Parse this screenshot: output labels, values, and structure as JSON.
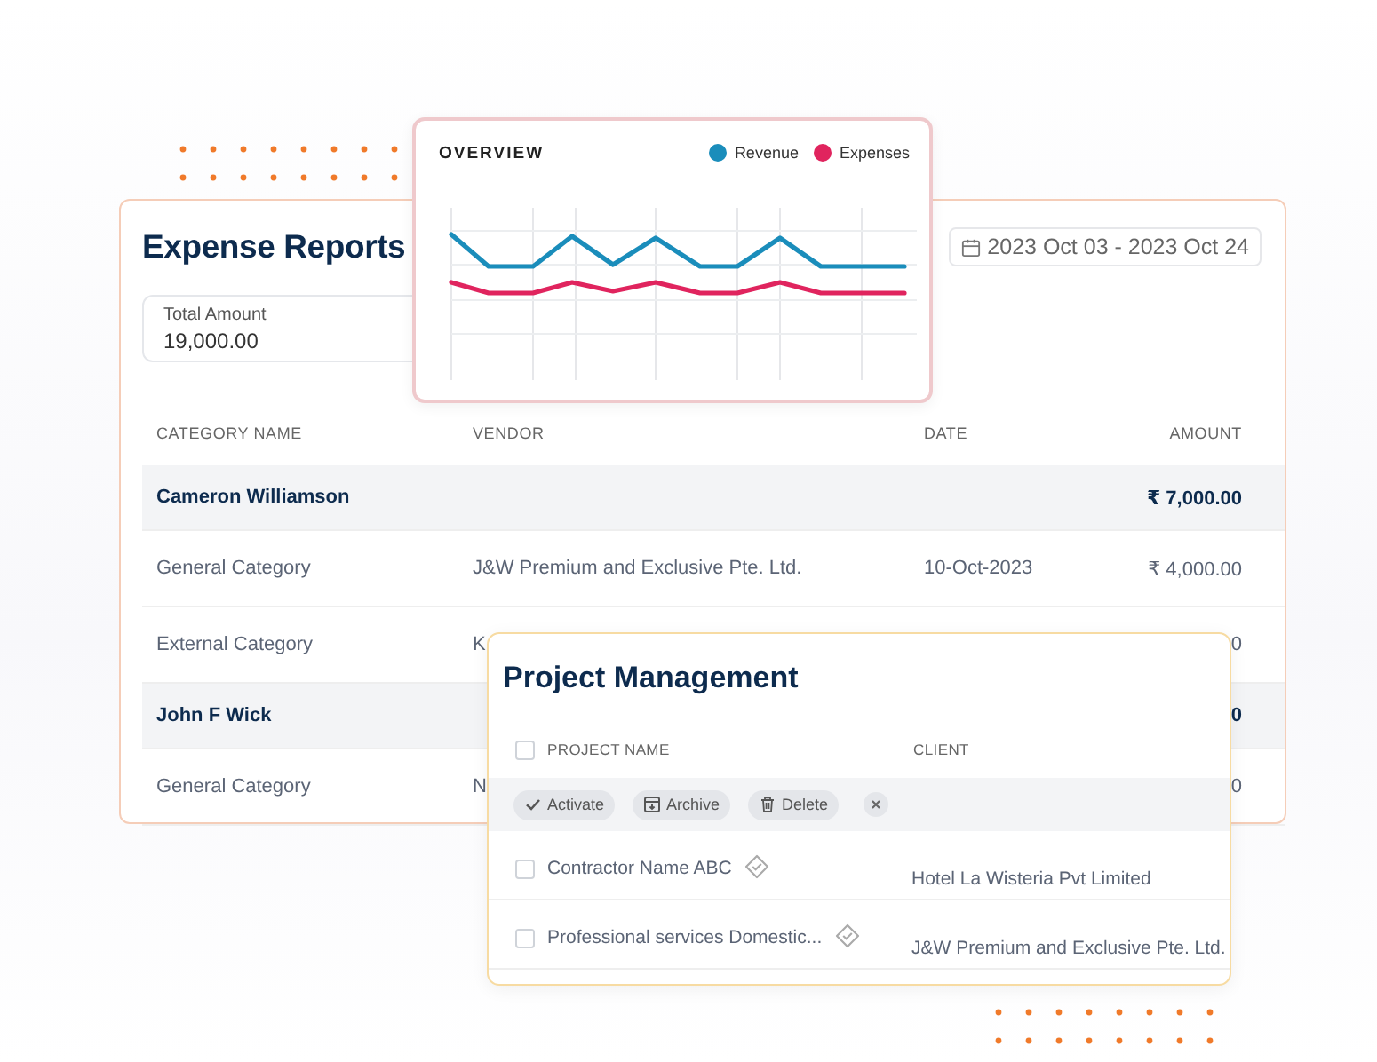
{
  "expense_report": {
    "title": "Expense Reports",
    "total": {
      "label": "Total Amount",
      "value": "19,000.00"
    },
    "date_range": "2023 Oct 03 - 2023 Oct 24",
    "columns": [
      "CATEGORY NAME",
      "VENDOR",
      "DATE",
      "AMOUNT"
    ],
    "rows": [
      {
        "kind": "group",
        "category": "Cameron Williamson",
        "amount": "₹ 7,000.00"
      },
      {
        "kind": "item",
        "category": "General Category",
        "vendor": "J&W Premium and Exclusive Pte. Ltd.",
        "date": "10-Oct-2023",
        "amount": "₹ 4,000.00"
      },
      {
        "kind": "item",
        "category": "External Category",
        "vendor": "K",
        "amount": "0"
      },
      {
        "kind": "group",
        "category": "John F Wick",
        "amount": "0"
      },
      {
        "kind": "item",
        "category": "General Category",
        "vendor": "N",
        "amount": "0"
      }
    ]
  },
  "overview": {
    "title": "OVERVIEW",
    "legend": [
      {
        "name": "Revenue",
        "color": "#1a8dbb"
      },
      {
        "name": "Expenses",
        "color": "#e0245e"
      }
    ]
  },
  "project_management": {
    "title": "Project Management",
    "header_checked": false,
    "columns": [
      "PROJECT NAME",
      "CLIENT"
    ],
    "actions": [
      {
        "kind": "activate",
        "label": "Activate"
      },
      {
        "kind": "archive",
        "label": "Archive"
      },
      {
        "kind": "delete",
        "label": "Delete"
      }
    ],
    "rows": [
      {
        "name": "Contractor Name ABC",
        "client": "Hotel La Wisteria Pvt Limited",
        "checked": false
      },
      {
        "name": "Professional services Domestic...",
        "client": "J&W Premium and Exclusive Pte. Ltd.",
        "checked": false
      }
    ]
  }
}
